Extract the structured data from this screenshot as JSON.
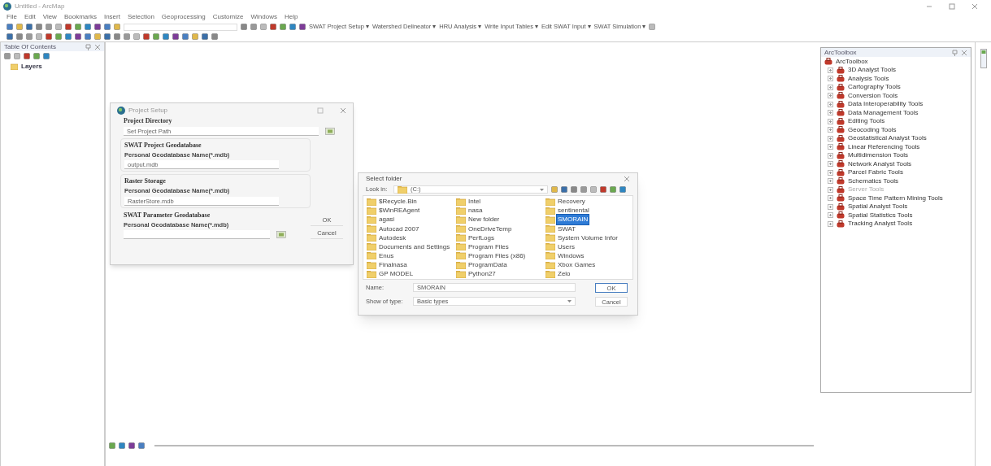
{
  "window": {
    "title": "Untitled - ArcMap"
  },
  "menu": [
    "File",
    "Edit",
    "View",
    "Bookmarks",
    "Insert",
    "Selection",
    "Geoprocessing",
    "Customize",
    "Windows",
    "Help"
  ],
  "swat_toolbar": [
    "SWAT Project Setup ▾",
    "Watershed Delineator ▾",
    "HRU Analysis ▾",
    "Write Input Tables ▾",
    "Edit SWAT Input ▾",
    "SWAT Simulation ▾"
  ],
  "toc": {
    "title": "Table Of Contents",
    "layers": "Layers"
  },
  "project_setup": {
    "title": "Project Setup",
    "sections": [
      {
        "kind": "plain",
        "heading": "Project Directory",
        "field_value": "Set Project Path",
        "browse": true
      },
      {
        "kind": "group",
        "heading": "SWAT Project Geodatabase",
        "label": "Personal Geodatabase Name(*.mdb)",
        "field_value": "output.mdb",
        "browse": false
      },
      {
        "kind": "group",
        "heading": "Raster Storage",
        "label": "Personal Geodatabase Name(*.mdb)",
        "field_value": "RasterStore.mdb",
        "browse": false
      },
      {
        "kind": "plain",
        "heading": "SWAT Parameter Geodatabase",
        "label": "Personal Geodatabase Name(*.mdb)",
        "browse": true
      }
    ],
    "buttons": [
      "OK",
      "Cancel"
    ]
  },
  "select_folder": {
    "title": "Select folder",
    "look_in_label": "Look in:",
    "look_in_value": "(C:)",
    "folders": [
      {
        "name": "$Recycle.Bin",
        "selected": false
      },
      {
        "name": "$WinREAgent",
        "selected": false
      },
      {
        "name": "agasi",
        "selected": false
      },
      {
        "name": "Autocad 2007",
        "selected": false
      },
      {
        "name": "Autodesk",
        "selected": false
      },
      {
        "name": "Documents and Settings",
        "selected": false
      },
      {
        "name": "Enus",
        "selected": false
      },
      {
        "name": "Finalnasa",
        "selected": false
      },
      {
        "name": "GP MODEL",
        "selected": false
      },
      {
        "name": "Intel",
        "selected": false
      },
      {
        "name": "nasa",
        "selected": false
      },
      {
        "name": "New folder",
        "selected": false
      },
      {
        "name": "OneDriveTemp",
        "selected": false
      },
      {
        "name": "PerfLogs",
        "selected": false
      },
      {
        "name": "Program Files",
        "selected": false
      },
      {
        "name": "Program Files (x86)",
        "selected": false
      },
      {
        "name": "ProgramData",
        "selected": false
      },
      {
        "name": "Python27",
        "selected": false
      },
      {
        "name": "Recovery",
        "selected": false
      },
      {
        "name": "sentinental",
        "selected": false
      },
      {
        "name": "SMORAIN",
        "selected": true
      },
      {
        "name": "SWAT",
        "selected": false
      },
      {
        "name": "System Volume Infor",
        "selected": false
      },
      {
        "name": "Users",
        "selected": false
      },
      {
        "name": "Windows",
        "selected": false
      },
      {
        "name": "Xbox Games",
        "selected": false
      },
      {
        "name": "Zelo",
        "selected": false
      }
    ],
    "name_label": "Name:",
    "name_value": "SMORAIN",
    "type_label": "Show of type:",
    "type_value": "Basic types",
    "buttons": [
      "OK",
      "Cancel"
    ]
  },
  "arctoolbox": {
    "title": "ArcToolbox",
    "root": {
      "label": "ArcToolbox",
      "children": [
        {
          "label": "3D Analyst Tools",
          "disabled": false
        },
        {
          "label": "Analysis Tools",
          "disabled": false
        },
        {
          "label": "Cartography Tools",
          "disabled": false
        },
        {
          "label": "Conversion Tools",
          "disabled": false
        },
        {
          "label": "Data Interoperability Tools",
          "disabled": false
        },
        {
          "label": "Data Management Tools",
          "disabled": false
        },
        {
          "label": "Editing Tools",
          "disabled": false
        },
        {
          "label": "Geocoding Tools",
          "disabled": false
        },
        {
          "label": "Geostatistical Analyst Tools",
          "disabled": false
        },
        {
          "label": "Linear Referencing Tools",
          "disabled": false
        },
        {
          "label": "Multidimension Tools",
          "disabled": false
        },
        {
          "label": "Network Analyst Tools",
          "disabled": false
        },
        {
          "label": "Parcel Fabric Tools",
          "disabled": false
        },
        {
          "label": "Schematics Tools",
          "disabled": false
        },
        {
          "label": "Server Tools",
          "disabled": true
        },
        {
          "label": "Space Time Pattern Mining Tools",
          "disabled": false
        },
        {
          "label": "Spatial Analyst Tools",
          "disabled": false
        },
        {
          "label": "Spatial Statistics Tools",
          "disabled": false
        },
        {
          "label": "Tracking Analyst Tools",
          "disabled": false
        }
      ]
    }
  }
}
